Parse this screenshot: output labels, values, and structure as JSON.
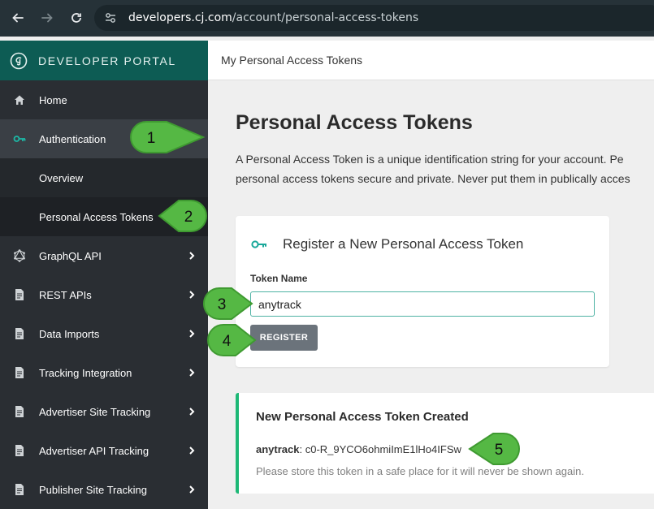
{
  "browser": {
    "url_domain": "developers.cj.com",
    "url_path": "/account/personal-access-tokens"
  },
  "brand": {
    "title": "DEVELOPER PORTAL"
  },
  "sidebar": {
    "items": [
      {
        "label": "Home",
        "icon": "home-icon"
      },
      {
        "label": "Authentication",
        "icon": "key-icon"
      },
      {
        "label": "Overview"
      },
      {
        "label": "Personal Access Tokens"
      },
      {
        "label": "GraphQL API",
        "icon": "graphql-icon"
      },
      {
        "label": "REST APIs",
        "icon": "document-icon"
      },
      {
        "label": "Data Imports",
        "icon": "document-icon"
      },
      {
        "label": "Tracking Integration",
        "icon": "document-icon"
      },
      {
        "label": "Advertiser Site Tracking",
        "icon": "document-icon"
      },
      {
        "label": "Advertiser API Tracking",
        "icon": "document-icon"
      },
      {
        "label": "Publisher Site Tracking",
        "icon": "document-icon"
      }
    ]
  },
  "header": {
    "breadcrumb": "My Personal Access Tokens"
  },
  "page": {
    "title": "Personal Access Tokens",
    "desc_line1": "A Personal Access Token is a unique identification string for your account. Pe",
    "desc_line2": "personal access tokens secure and private. Never put them in publically acces"
  },
  "register": {
    "title": "Register a New Personal Access Token",
    "field_label": "Token Name",
    "field_value": "anytrack",
    "button_label": "REGISTER"
  },
  "result": {
    "title": "New Personal Access Token Created",
    "token_name": "anytrack",
    "token_value": ": c0-R_9YCO6ohmiImE1lHo4IFSw",
    "note": "Please store this token in a safe place for it will never be shown again."
  },
  "callouts": [
    "1",
    "2",
    "3",
    "4",
    "5"
  ],
  "colors": {
    "brand": "#0d5c54",
    "sidebar": "#2a2e33",
    "callout": "#55b844",
    "success": "#1db876",
    "input_focus": "#4fb3a4"
  }
}
